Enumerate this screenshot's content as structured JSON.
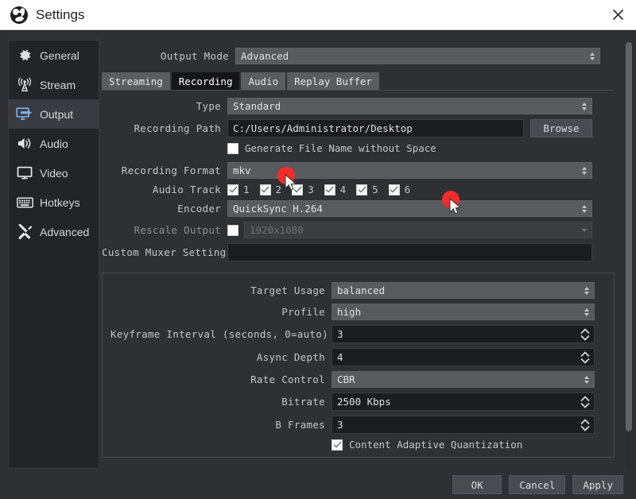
{
  "window": {
    "title": "Settings",
    "logo_icon": "obs-logo-icon",
    "close_icon": "close-icon"
  },
  "sidebar": {
    "items": [
      {
        "label": "General",
        "icon": "gear-icon",
        "selected": false
      },
      {
        "label": "Stream",
        "icon": "broadcast-icon",
        "selected": false
      },
      {
        "label": "Output",
        "icon": "output-icon",
        "selected": true
      },
      {
        "label": "Audio",
        "icon": "speaker-icon",
        "selected": false
      },
      {
        "label": "Video",
        "icon": "monitor-icon",
        "selected": false
      },
      {
        "label": "Hotkeys",
        "icon": "keyboard-icon",
        "selected": false
      },
      {
        "label": "Advanced",
        "icon": "tools-icon",
        "selected": false
      }
    ]
  },
  "main": {
    "output_mode": {
      "label": "Output Mode",
      "value": "Advanced"
    },
    "tabs": [
      {
        "label": "Streaming",
        "active": false
      },
      {
        "label": "Recording",
        "active": true
      },
      {
        "label": "Audio",
        "active": false
      },
      {
        "label": "Replay Buffer",
        "active": false
      }
    ],
    "type": {
      "label": "Type",
      "value": "Standard"
    },
    "recording_path": {
      "label": "Recording Path",
      "value": "C:/Users/Administrator/Desktop",
      "browse_label": "Browse"
    },
    "generate_file_name": {
      "label": "Generate File Name without Space",
      "checked": false
    },
    "recording_format": {
      "label": "Recording Format",
      "value": "mkv"
    },
    "audio_track": {
      "label": "Audio Track",
      "tracks": [
        {
          "number": "1",
          "checked": true
        },
        {
          "number": "2",
          "checked": true
        },
        {
          "number": "3",
          "checked": true
        },
        {
          "number": "4",
          "checked": true
        },
        {
          "number": "5",
          "checked": true
        },
        {
          "number": "6",
          "checked": true
        }
      ]
    },
    "encoder": {
      "label": "Encoder",
      "value": "QuickSync H.264"
    },
    "rescale_output": {
      "label": "Rescale Output",
      "checked": false,
      "value": "1920x1080",
      "disabled": true
    },
    "custom_muxer": {
      "label": "Custom Muxer Settings",
      "value": ""
    },
    "encoder_settings": {
      "target_usage": {
        "label": "Target Usage",
        "value": "balanced"
      },
      "profile": {
        "label": "Profile",
        "value": "high"
      },
      "keyframe_interval": {
        "label": "Keyframe Interval (seconds, 0=auto)",
        "value": "3"
      },
      "async_depth": {
        "label": "Async Depth",
        "value": "4"
      },
      "rate_control": {
        "label": "Rate Control",
        "value": "CBR"
      },
      "bitrate": {
        "label": "Bitrate",
        "value": "2500 Kbps"
      },
      "b_frames": {
        "label": "B Frames",
        "value": "3"
      },
      "caq": {
        "label": "Content Adaptive Quantization",
        "checked": true
      }
    }
  },
  "footer": {
    "ok_label": "OK",
    "cancel_label": "Cancel",
    "apply_label": "Apply"
  },
  "colors": {
    "accent_selected_icon": "#6aa6e0",
    "cursor_marker": "#f22b2b",
    "titlebar_bg": "#ffffff",
    "window_bg": "#2f3033"
  }
}
